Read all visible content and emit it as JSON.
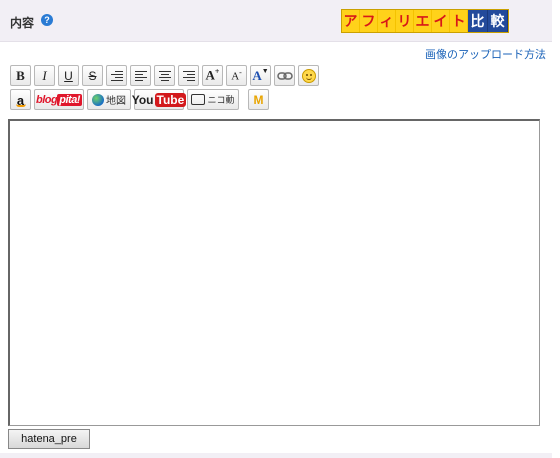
{
  "header": {
    "title": "内容",
    "help_icon": "help-icon"
  },
  "affiliate_banner": {
    "chars": [
      "ア",
      "フ",
      "ィ",
      "リ",
      "エ",
      "イ",
      "ト"
    ],
    "suffix_chars": [
      "比",
      "較"
    ],
    "colors": {
      "bg": "#ffd21a",
      "text": "#d81818",
      "suffix_bg": "#234a9b"
    }
  },
  "upload_link": "画像のアップロード方法",
  "toolbar": {
    "row1": [
      {
        "name": "bold-button",
        "label": "B"
      },
      {
        "name": "italic-button",
        "label": "I"
      },
      {
        "name": "underline-button",
        "label": "U"
      },
      {
        "name": "strikethrough-button",
        "label": "S"
      },
      {
        "name": "indent-button",
        "icon": "indent-icon"
      },
      {
        "name": "align-left-button",
        "icon": "align-left-icon"
      },
      {
        "name": "align-center-button",
        "icon": "align-center-icon"
      },
      {
        "name": "align-right-button",
        "icon": "align-right-icon"
      },
      {
        "name": "font-size-up-button",
        "label": "A",
        "sup": "+"
      },
      {
        "name": "font-size-down-button",
        "label": "A",
        "sup": "-"
      },
      {
        "name": "font-color-button",
        "label": "A"
      },
      {
        "name": "link-button",
        "icon": "link-icon"
      },
      {
        "name": "emoji-button",
        "icon": "smile-icon"
      }
    ],
    "row2": {
      "amazon": "a",
      "blogpita_prefix": "blog",
      "blogpita_suffix": "pita!",
      "map_label": "地図",
      "youtube_you": "You",
      "youtube_tube": "Tube",
      "nico_label": "ニコ動",
      "mstar": "M"
    }
  },
  "editor": {
    "content": ""
  },
  "hatena_button": "hatena_pre"
}
